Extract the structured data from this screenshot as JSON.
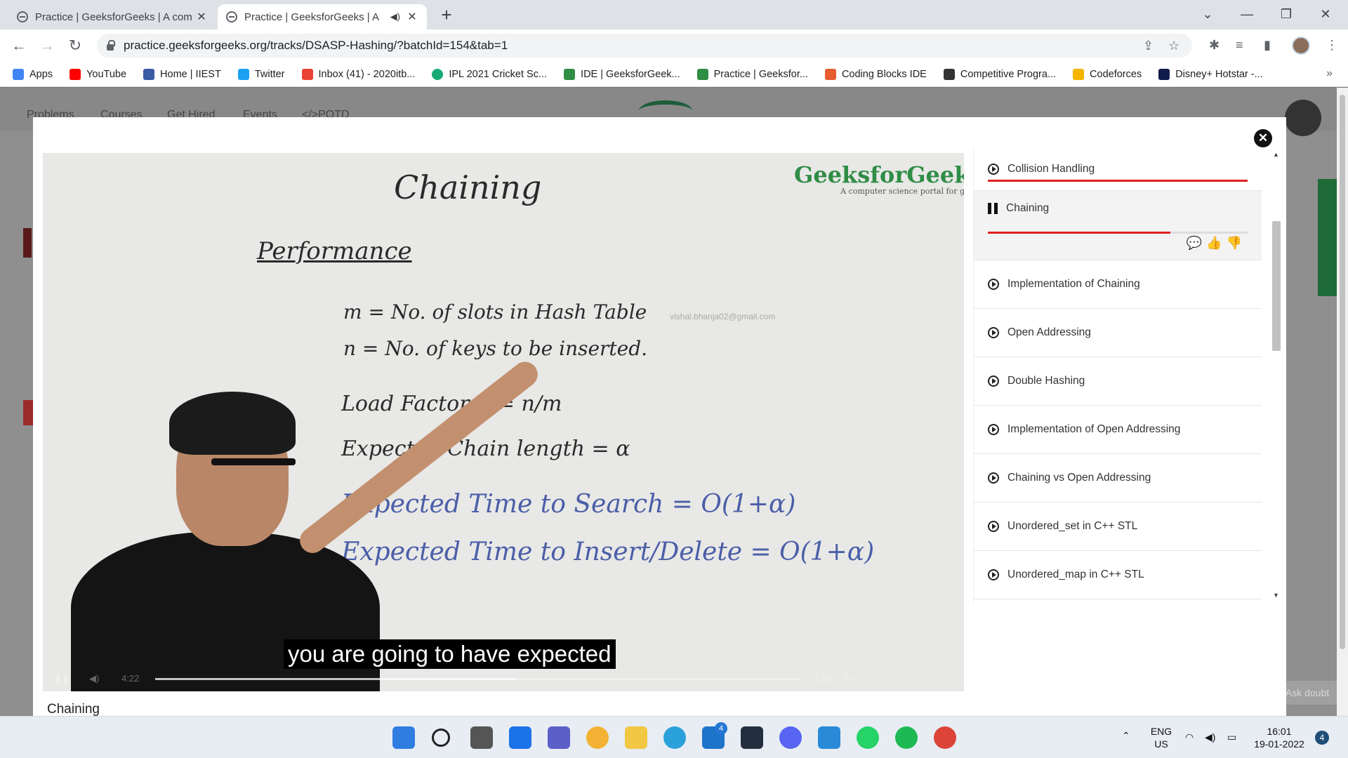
{
  "browser": {
    "tabs": [
      {
        "title": "Practice | GeeksforGeeks | A com",
        "active": false
      },
      {
        "title": "Practice | GeeksforGeeks | A",
        "active": true,
        "audio": "◀)"
      }
    ],
    "url": "practice.geeksforgeeks.org/tracks/DSASP-Hashing/?batchId=154&tab=1",
    "bookmarks": [
      {
        "label": "Apps",
        "color": "#4285f4"
      },
      {
        "label": "YouTube",
        "color": "#ff0000"
      },
      {
        "label": "Home | IIEST",
        "color": "#3b5ba5"
      },
      {
        "label": "Twitter",
        "color": "#1da1f2"
      },
      {
        "label": "Inbox (41) - 2020itb...",
        "color": "#ea4335"
      },
      {
        "label": "IPL 2021 Cricket Sc...",
        "color": "#19a974"
      },
      {
        "label": "IDE | GeeksforGeek...",
        "color": "#2f8d46"
      },
      {
        "label": "Practice | Geeksfor...",
        "color": "#2f8d46"
      },
      {
        "label": "Coding Blocks IDE",
        "color": "#e65c2f"
      },
      {
        "label": "Competitive Progra...",
        "color": "#333333"
      },
      {
        "label": "Codeforces",
        "color": "#f4b400"
      },
      {
        "label": "Disney+ Hotstar -...",
        "color": "#0f1c4d"
      }
    ]
  },
  "background_page": {
    "nav": [
      "Problems",
      "Courses",
      "Get Hired",
      "Events",
      "</>POTD"
    ],
    "ask_doubt": "Ask doubt"
  },
  "video": {
    "whiteboard": {
      "title": "Chaining",
      "heading": "Performance",
      "line1": "m = No. of slots in Hash Table",
      "line2": "n = No. of keys to be inserted.",
      "line3": "Load Factor α = n/m",
      "line4": "Expected Chain length = α",
      "line5": "Expected Time to Search = O(1+α)",
      "line6": "Expected Time to Insert/Delete = O(1+α)"
    },
    "watermark": "vishal.bhanja02@gmail.com",
    "brand": "GeeksforGeeks",
    "brand_tagline": "A computer science portal for geeks",
    "subtitle": "you are going to have expected",
    "time_elapsed": "4:22",
    "time_remaining": "-1:53",
    "speed": "2x",
    "progress": 0.56
  },
  "video_title": "Chaining",
  "playlist": [
    {
      "title": "Collision Handling",
      "state": "completed"
    },
    {
      "title": "Chaining",
      "state": "playing"
    },
    {
      "title": "Implementation of Chaining",
      "state": "idle"
    },
    {
      "title": "Open Addressing",
      "state": "idle"
    },
    {
      "title": "Double Hashing",
      "state": "idle"
    },
    {
      "title": "Implementation of Open Addressing",
      "state": "idle"
    },
    {
      "title": "Chaining vs Open Addressing",
      "state": "idle"
    },
    {
      "title": "Unordered_set in C++ STL",
      "state": "idle"
    },
    {
      "title": "Unordered_map in C++ STL",
      "state": "idle"
    }
  ],
  "taskbar": {
    "lang": "ENG",
    "region": "US",
    "time": "16:01",
    "date": "19-01-2022",
    "notifications": "4",
    "mail_badge": "4"
  }
}
